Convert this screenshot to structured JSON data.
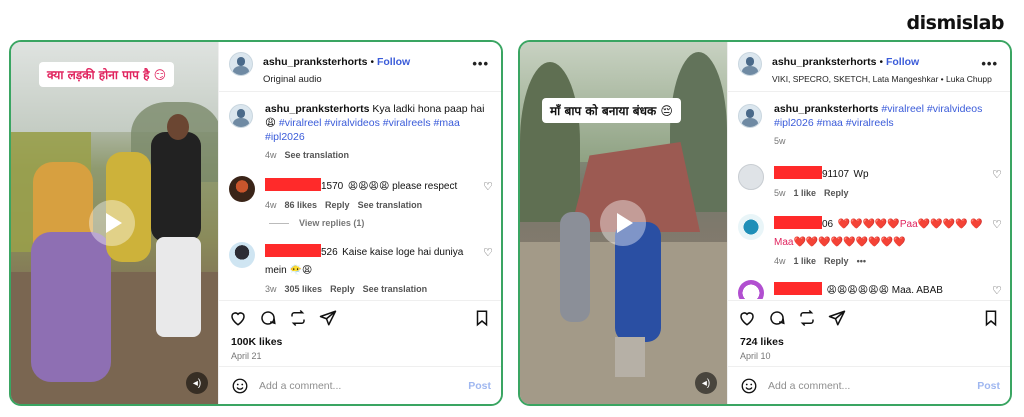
{
  "brand": "dismislab",
  "cards": [
    {
      "caption": "क्या लड़की होना पाप है 😏",
      "header": {
        "username": "ashu_pranksterhorts",
        "separator": "•",
        "follow": "Follow",
        "audio": "Original audio"
      },
      "post": {
        "username": "ashu_pranksterhorts",
        "text": "Kya ladki hona paap hai😩",
        "tags": "#viralreel #viralvideos #viralreels #maa #ipl2026",
        "time": "4w",
        "translate": "See translation"
      },
      "comments": [
        {
          "handle_suffix": "1570",
          "text": "😩😩😩😩 please respect",
          "time": "4w",
          "likes": "86 likes",
          "reply": "Reply",
          "translate": "See translation",
          "view_replies": "View replies (1)"
        },
        {
          "handle_suffix": "526",
          "text": "Kaise kaise loge hai duniya mein 😶‍🌫️😩",
          "time": "3w",
          "likes": "305 likes",
          "reply": "Reply",
          "translate": "See translation"
        }
      ],
      "likes": "100K likes",
      "date": "April 21",
      "add_comment": "Add a comment...",
      "post_btn": "Post"
    },
    {
      "caption": "माँ बाप को बनाया बंधक 😔",
      "header": {
        "username": "ashu_pranksterhorts",
        "separator": "•",
        "follow": "Follow",
        "audio": "VIKI, SPECRO, SKETCH, Lata Mangeshkar • Luka Chupp"
      },
      "post": {
        "username": "ashu_pranksterhorts",
        "text": "",
        "tags": "#viralreel #viralvideos #ipl2026 #maa #viralreels",
        "time": "5w",
        "translate": ""
      },
      "comments": [
        {
          "handle_suffix": "91107",
          "text": "Wp",
          "time": "5w",
          "likes": "1 like",
          "reply": "Reply",
          "translate": ""
        },
        {
          "handle_suffix": "06",
          "text": "❤️❤️❤️❤️❤️Paa❤️❤️❤️❤️ ❤️Maa❤️❤️❤️❤️❤️❤️❤️❤️❤️",
          "time": "4w",
          "likes": "1 like",
          "reply": "Reply",
          "more": "•••"
        },
        {
          "handle_suffix": "",
          "text": "😩😩😩😩😩😩 Maa. ABAB",
          "time": "",
          "likes": "",
          "reply": ""
        }
      ],
      "likes": "724 likes",
      "date": "April 10",
      "add_comment": "Add a comment...",
      "post_btn": "Post"
    }
  ]
}
